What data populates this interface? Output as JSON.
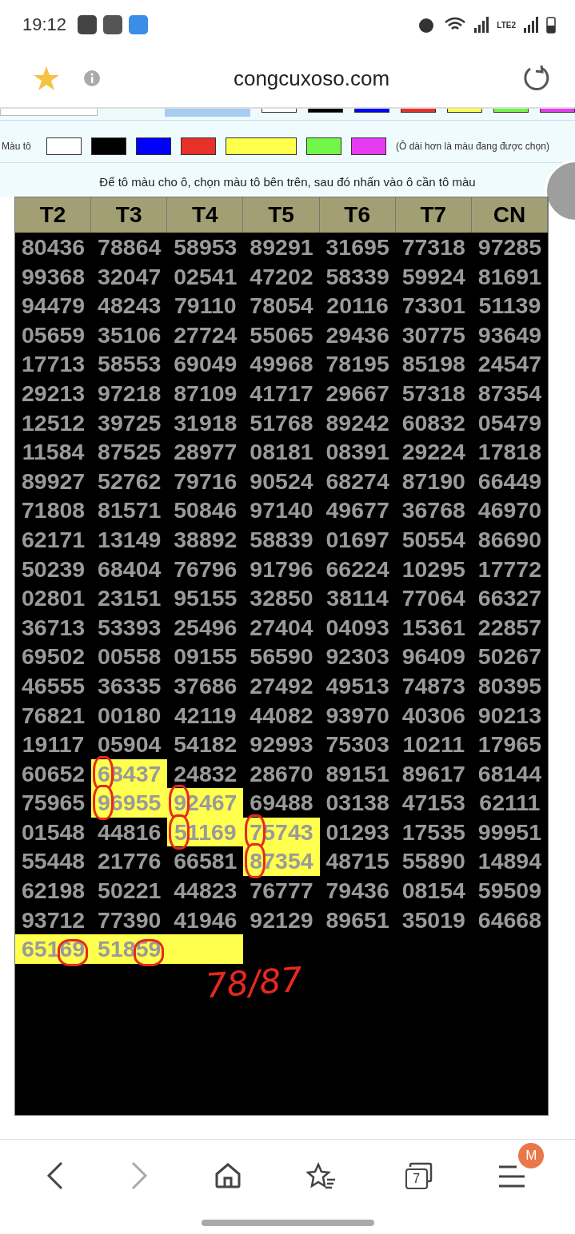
{
  "status_bar": {
    "time": "19:12",
    "network": "LTE2"
  },
  "address_bar": {
    "url": "congcuxoso.com"
  },
  "palette": {
    "label": "Màu tô",
    "note": "(Ô dài hơn là màu đang được chọn)",
    "swatches": [
      {
        "color": "#ffffff",
        "selected": false
      },
      {
        "color": "#000000",
        "selected": false
      },
      {
        "color": "#0000ff",
        "selected": false
      },
      {
        "color": "#e8302a",
        "selected": false
      },
      {
        "color": "#ffff4d",
        "selected": true
      },
      {
        "color": "#73f64a",
        "selected": false
      },
      {
        "color": "#e63cf0",
        "selected": false
      }
    ]
  },
  "instruction": "Để tô màu cho ô, chọn màu tô bên trên, sau đó nhấn vào ô cần tô màu",
  "table": {
    "columns": [
      "T2",
      "T3",
      "T4",
      "T5",
      "T6",
      "T7",
      "CN"
    ],
    "rows": [
      [
        {
          "text": "80436"
        },
        {
          "text": "78864"
        },
        {
          "text": "58953"
        },
        {
          "text": "89291"
        },
        {
          "text": "31695"
        },
        {
          "text": "77318"
        },
        {
          "text": "97285"
        }
      ],
      [
        {
          "text": "99368"
        },
        {
          "text": "32047"
        },
        {
          "text": "02541"
        },
        {
          "text": "47202"
        },
        {
          "text": "58339"
        },
        {
          "text": "59924"
        },
        {
          "text": "81691"
        }
      ],
      [
        {
          "text": "94479"
        },
        {
          "text": "48243"
        },
        {
          "text": "79110"
        },
        {
          "text": "78054"
        },
        {
          "text": "20116"
        },
        {
          "text": "73301"
        },
        {
          "text": "51139"
        }
      ],
      [
        {
          "text": "05659"
        },
        {
          "text": "35106"
        },
        {
          "text": "27724"
        },
        {
          "text": "55065"
        },
        {
          "text": "29436"
        },
        {
          "text": "30775"
        },
        {
          "text": "93649"
        }
      ],
      [
        {
          "text": "17713"
        },
        {
          "text": "58553"
        },
        {
          "text": "69049"
        },
        {
          "text": "49968"
        },
        {
          "text": "78195"
        },
        {
          "text": "85198"
        },
        {
          "text": "24547"
        }
      ],
      [
        {
          "text": "29213"
        },
        {
          "text": "97218"
        },
        {
          "text": "87109"
        },
        {
          "text": "41717"
        },
        {
          "text": "29667"
        },
        {
          "text": "57318"
        },
        {
          "text": "87354"
        }
      ],
      [
        {
          "text": "12512"
        },
        {
          "text": "39725"
        },
        {
          "text": "31918"
        },
        {
          "text": "51768"
        },
        {
          "text": "89242"
        },
        {
          "text": "60832"
        },
        {
          "text": "05479"
        }
      ],
      [
        {
          "text": "11584"
        },
        {
          "text": "87525"
        },
        {
          "text": "28977"
        },
        {
          "text": "08181"
        },
        {
          "text": "08391"
        },
        {
          "text": "29224"
        },
        {
          "text": "17818"
        }
      ],
      [
        {
          "text": "89927"
        },
        {
          "text": "52762"
        },
        {
          "text": "79716"
        },
        {
          "text": "90524"
        },
        {
          "text": "68274"
        },
        {
          "text": "87190"
        },
        {
          "text": "66449"
        }
      ],
      [
        {
          "text": "71808"
        },
        {
          "text": "81571"
        },
        {
          "text": "50846"
        },
        {
          "text": "97140"
        },
        {
          "text": "49677"
        },
        {
          "text": "36768"
        },
        {
          "text": "46970"
        }
      ],
      [
        {
          "text": "62171"
        },
        {
          "text": "13149"
        },
        {
          "text": "38892"
        },
        {
          "text": "58839"
        },
        {
          "text": "01697"
        },
        {
          "text": "50554"
        },
        {
          "text": "86690"
        }
      ],
      [
        {
          "text": "50239"
        },
        {
          "text": "68404"
        },
        {
          "text": "76796"
        },
        {
          "text": "91796"
        },
        {
          "text": "66224"
        },
        {
          "text": "10295"
        },
        {
          "text": "17772"
        }
      ],
      [
        {
          "text": "02801"
        },
        {
          "text": "23151"
        },
        {
          "text": "95155"
        },
        {
          "text": "32850"
        },
        {
          "text": "38114"
        },
        {
          "text": "77064"
        },
        {
          "text": "66327"
        }
      ],
      [
        {
          "text": "36713"
        },
        {
          "text": "53393"
        },
        {
          "text": "25496"
        },
        {
          "text": "27404"
        },
        {
          "text": "04093"
        },
        {
          "text": "15361"
        },
        {
          "text": "22857"
        }
      ],
      [
        {
          "text": "69502"
        },
        {
          "text": "00558"
        },
        {
          "text": "09155"
        },
        {
          "text": "56590"
        },
        {
          "text": "92303"
        },
        {
          "text": "96409"
        },
        {
          "text": "50267"
        }
      ],
      [
        {
          "text": "46555"
        },
        {
          "text": "36335"
        },
        {
          "text": "37686"
        },
        {
          "text": "27492"
        },
        {
          "text": "49513"
        },
        {
          "text": "74873"
        },
        {
          "text": "80395"
        }
      ],
      [
        {
          "text": "76821"
        },
        {
          "text": "00180"
        },
        {
          "text": "42119"
        },
        {
          "text": "44082"
        },
        {
          "text": "93970"
        },
        {
          "text": "40306"
        },
        {
          "text": "90213"
        }
      ],
      [
        {
          "text": "19117"
        },
        {
          "text": "05904"
        },
        {
          "text": "54182"
        },
        {
          "text": "92993"
        },
        {
          "text": "75303"
        },
        {
          "text": "10211"
        },
        {
          "text": "17965"
        }
      ],
      [
        {
          "text": "60652"
        },
        {
          "text": "68437",
          "highlighted": true,
          "circled_start": true
        },
        {
          "text": "24832"
        },
        {
          "text": "28670"
        },
        {
          "text": "89151"
        },
        {
          "text": "89617"
        },
        {
          "text": "68144"
        }
      ],
      [
        {
          "text": "75965"
        },
        {
          "text": "96955",
          "highlighted": true,
          "circled_start": true
        },
        {
          "text": "92467",
          "highlighted": true,
          "circled_start": true
        },
        {
          "text": "69488"
        },
        {
          "text": "03138"
        },
        {
          "text": "47153"
        },
        {
          "text": "62111"
        }
      ],
      [
        {
          "text": "01548"
        },
        {
          "text": "44816"
        },
        {
          "text": "51169",
          "highlighted": true,
          "circled_start": true
        },
        {
          "text": "75743",
          "highlighted": true,
          "circled_start": true
        },
        {
          "text": "01293"
        },
        {
          "text": "17535"
        },
        {
          "text": "99951"
        }
      ],
      [
        {
          "text": "55448"
        },
        {
          "text": "21776"
        },
        {
          "text": "66581"
        },
        {
          "text": "87354",
          "highlighted": true,
          "circled_start": true
        },
        {
          "text": "48715"
        },
        {
          "text": "55890"
        },
        {
          "text": "14894"
        }
      ],
      [
        {
          "text": "62198"
        },
        {
          "text": "50221"
        },
        {
          "text": "44823"
        },
        {
          "text": "76777"
        },
        {
          "text": "79436"
        },
        {
          "text": "08154"
        },
        {
          "text": "59509"
        }
      ],
      [
        {
          "text": "93712"
        },
        {
          "text": "77390"
        },
        {
          "text": "41946"
        },
        {
          "text": "92129"
        },
        {
          "text": "89651"
        },
        {
          "text": "35019"
        },
        {
          "text": "64668"
        }
      ],
      [
        {
          "text": "65169",
          "highlighted": true,
          "circled_end": true
        },
        {
          "text": "51859",
          "highlighted": true,
          "circled_end": true
        },
        {
          "highlighted": true
        }
      ]
    ]
  },
  "annotation": {
    "text": "78/87"
  },
  "bottom_nav": {
    "tab_count": "7",
    "avatar_letter": "M"
  }
}
